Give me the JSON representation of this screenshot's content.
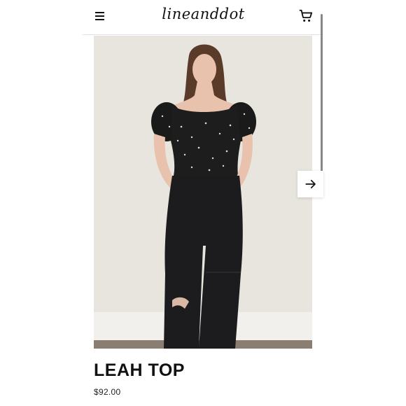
{
  "brand": {
    "logo_text": "lineanddot"
  },
  "product": {
    "name": "LEAH TOP",
    "price": "$92.00"
  },
  "icons": {
    "menu": "menu-icon",
    "cart": "cart-icon",
    "next": "arrow-right-icon"
  },
  "colors": {
    "text": "#111111",
    "border": "#e2e2e2",
    "image_background": "#e6e3dd"
  }
}
